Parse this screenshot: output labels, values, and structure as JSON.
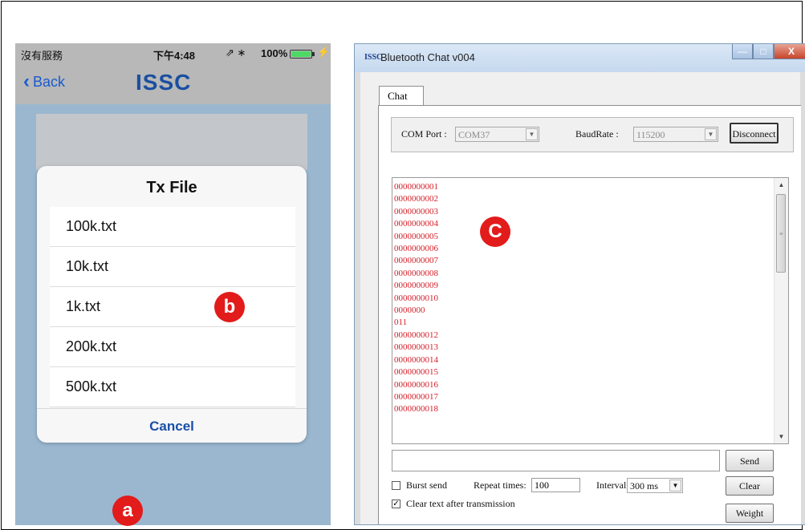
{
  "phone": {
    "status": {
      "carrier": "沒有服務",
      "time": "下午4:48",
      "icons": "⇗ ∗",
      "battery_pct": "100%",
      "battery_level": 1.0
    },
    "nav": {
      "back_label": "Back",
      "logo": "ISSC"
    },
    "dialog": {
      "title": "Tx File",
      "files": [
        "100k.txt",
        "10k.txt",
        "1k.txt",
        "200k.txt",
        "500k.txt"
      ],
      "cancel_label": "Cancel"
    }
  },
  "badges": {
    "a": "a",
    "b": "b",
    "c": "C"
  },
  "window": {
    "icon_text": "ISSC",
    "title": "Bluetooth Chat v004",
    "controls": {
      "minimize": "—",
      "maximize": "□",
      "close": "X"
    },
    "tab_label": "Chat",
    "com_port_label": "COM Port :",
    "com_port_value": "COM37",
    "baud_label": "BaudRate :",
    "baud_value": "115200",
    "disconnect_label": "Disconnect",
    "log_lines": [
      "0000000001",
      "0000000002",
      "0000000003",
      "0000000004",
      "0000000005",
      "0000000006",
      "0000000007",
      "0000000008",
      "0000000009",
      "0000000010",
      "0000000",
      "011",
      "0000000012",
      "0000000013",
      "0000000014",
      "0000000015",
      "0000000016",
      "0000000017",
      "0000000018"
    ],
    "send_input_value": "",
    "send_label": "Send",
    "burst_label": "Burst send",
    "repeat_label": "Repeat times:",
    "repeat_value": "100",
    "interval_label": "Interval:",
    "interval_value": "300 ms",
    "clear_label": "Clear",
    "clear_text_label": "Clear text after transmission",
    "weight_demo_label": "Weight Demo"
  },
  "colors": {
    "log_text": "#d4202a",
    "badge": "#e21b1b",
    "ios_blue": "#1a5bd0",
    "phone_bg": "#9ab7cf"
  }
}
